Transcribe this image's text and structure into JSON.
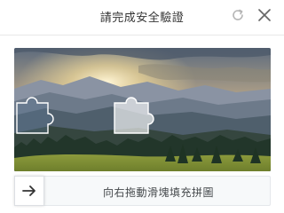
{
  "dialog": {
    "title": "請完成安全驗證",
    "refresh_icon": "refresh-icon",
    "close_icon": "close-icon"
  },
  "captcha": {
    "image_description": "mountain-landscape-sunset",
    "slider_hint": "向右拖動滑塊填充拼圖",
    "handle_icon": "arrow-right-icon"
  },
  "colors": {
    "text": "#333333",
    "icon": "#999999",
    "track_bg": "#f7f9fa",
    "track_border": "#e4e7eb"
  }
}
